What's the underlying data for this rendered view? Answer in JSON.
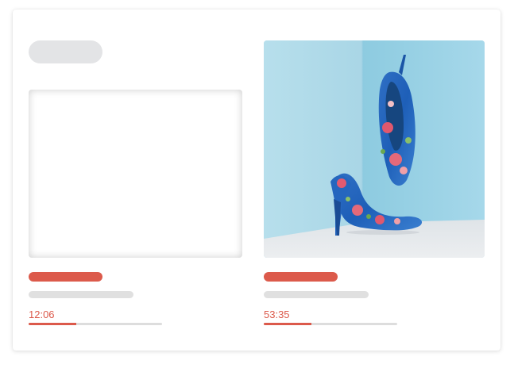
{
  "colors": {
    "accent": "#dc5a4b",
    "placeholder": "#e3e4e6",
    "track": "#dddddd"
  },
  "videos": [
    {
      "thumbnail": "blank-placeholder",
      "time": "12:06",
      "progress_percent": 36
    },
    {
      "thumbnail": "floral-high-heel-shoes-photo",
      "time": "53:35",
      "progress_percent": 36
    }
  ]
}
